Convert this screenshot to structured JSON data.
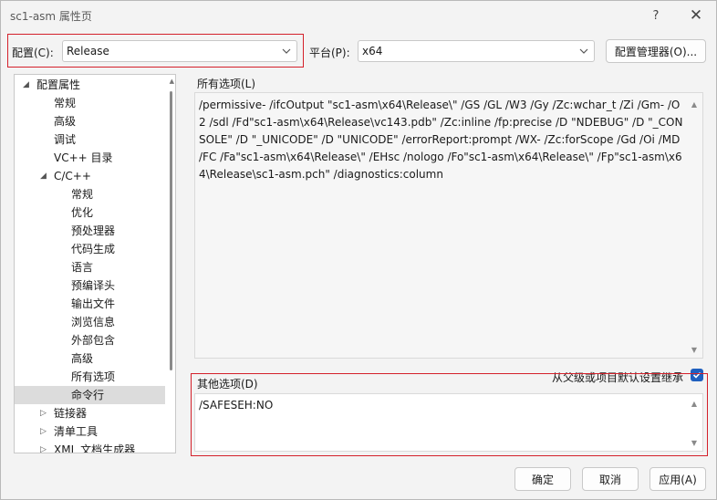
{
  "window": {
    "title": "sc1-asm 属性页",
    "help_icon": "?",
    "close_icon": "✕"
  },
  "config": {
    "label": "配置(C):",
    "value": "Release",
    "platform_label": "平台(P):",
    "platform_value": "x64",
    "manager_button": "配置管理器(O)..."
  },
  "tree": {
    "items": [
      {
        "label": "配置属性",
        "glyph": "◢",
        "level": 0
      },
      {
        "label": "常规",
        "level": 1
      },
      {
        "label": "高级",
        "level": 1
      },
      {
        "label": "调试",
        "level": 1
      },
      {
        "label": "VC++ 目录",
        "level": 1
      },
      {
        "label": "C/C++",
        "glyph": "◢",
        "level": 1
      },
      {
        "label": "常规",
        "level": 2
      },
      {
        "label": "优化",
        "level": 2
      },
      {
        "label": "预处理器",
        "level": 2
      },
      {
        "label": "代码生成",
        "level": 2
      },
      {
        "label": "语言",
        "level": 2
      },
      {
        "label": "预编译头",
        "level": 2
      },
      {
        "label": "输出文件",
        "level": 2
      },
      {
        "label": "浏览信息",
        "level": 2
      },
      {
        "label": "外部包含",
        "level": 2
      },
      {
        "label": "高级",
        "level": 2
      },
      {
        "label": "所有选项",
        "level": 2
      },
      {
        "label": "命令行",
        "level": 2,
        "selected": true
      },
      {
        "label": "链接器",
        "glyph": "▷",
        "level": 1
      },
      {
        "label": "清单工具",
        "glyph": "▷",
        "level": 1
      },
      {
        "label": "XML 文档生成器",
        "glyph": "▷",
        "level": 1
      }
    ]
  },
  "all_options": {
    "title": "所有选项(L)",
    "text": "/permissive- /ifcOutput \"sc1-asm\\x64\\Release\\\" /GS /GL /W3 /Gy /Zc:wchar_t /Zi /Gm- /O2 /sdl /Fd\"sc1-asm\\x64\\Release\\vc143.pdb\" /Zc:inline /fp:precise /D \"NDEBUG\" /D \"_CONSOLE\" /D \"_UNICODE\" /D \"UNICODE\" /errorReport:prompt /WX- /Zc:forScope /Gd /Oi /MD /FC /Fa\"sc1-asm\\x64\\Release\\\" /EHsc /nologo /Fo\"sc1-asm\\x64\\Release\\\" /Fp\"sc1-asm\\x64\\Release\\sc1-asm.pch\" /diagnostics:column"
  },
  "other_options": {
    "title": "其他选项(D)",
    "value": "/SAFESEH:NO",
    "inherit_label": "从父级或项目默认设置继承",
    "inherit_checked": true
  },
  "footer": {
    "ok": "确定",
    "cancel": "取消",
    "apply": "应用(A)"
  },
  "colors": {
    "highlight_border": "#d4202a",
    "checkbox": "#1f5fbf"
  }
}
